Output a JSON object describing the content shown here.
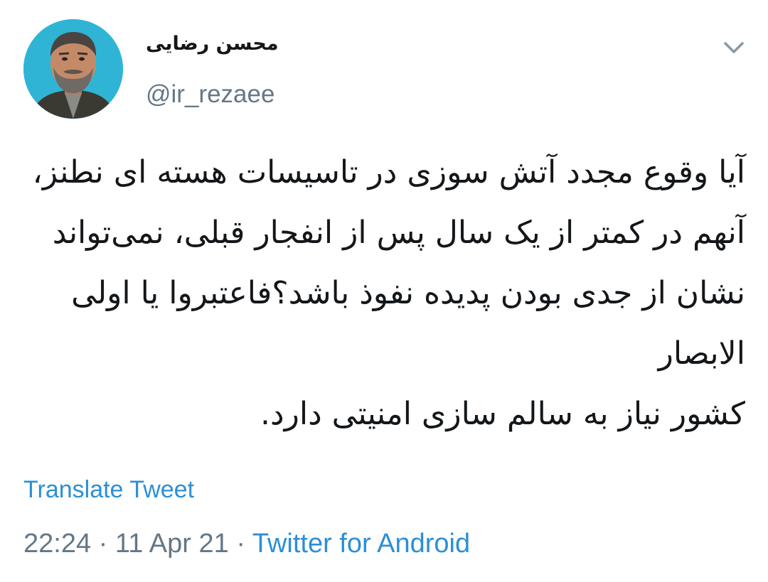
{
  "tweet": {
    "author": {
      "display_name": "محسن رضایی",
      "handle": "@ir_rezaee",
      "avatar_background": "#2fb4d6"
    },
    "menu_icon": "chevron-down-icon",
    "text": "آیا وقوع مجدد آتش سوزی در تاسیسات هسته ای نطنز، آنهم در کمتر از یک سال پس از انفجار قبلی، نمی‌تواند نشان از جدی بودن پدیده نفوذ باشد؟فاعتبروا یا اولی الابصار\nکشور نیاز به سالم سازی امنیتی دارد.",
    "translate_label": "Translate Tweet",
    "time": "22:24",
    "date": "11 Apr 21",
    "separator": "·",
    "source": "Twitter for Android",
    "link_color": "#2c8fd6",
    "secondary_color": "#657786"
  }
}
